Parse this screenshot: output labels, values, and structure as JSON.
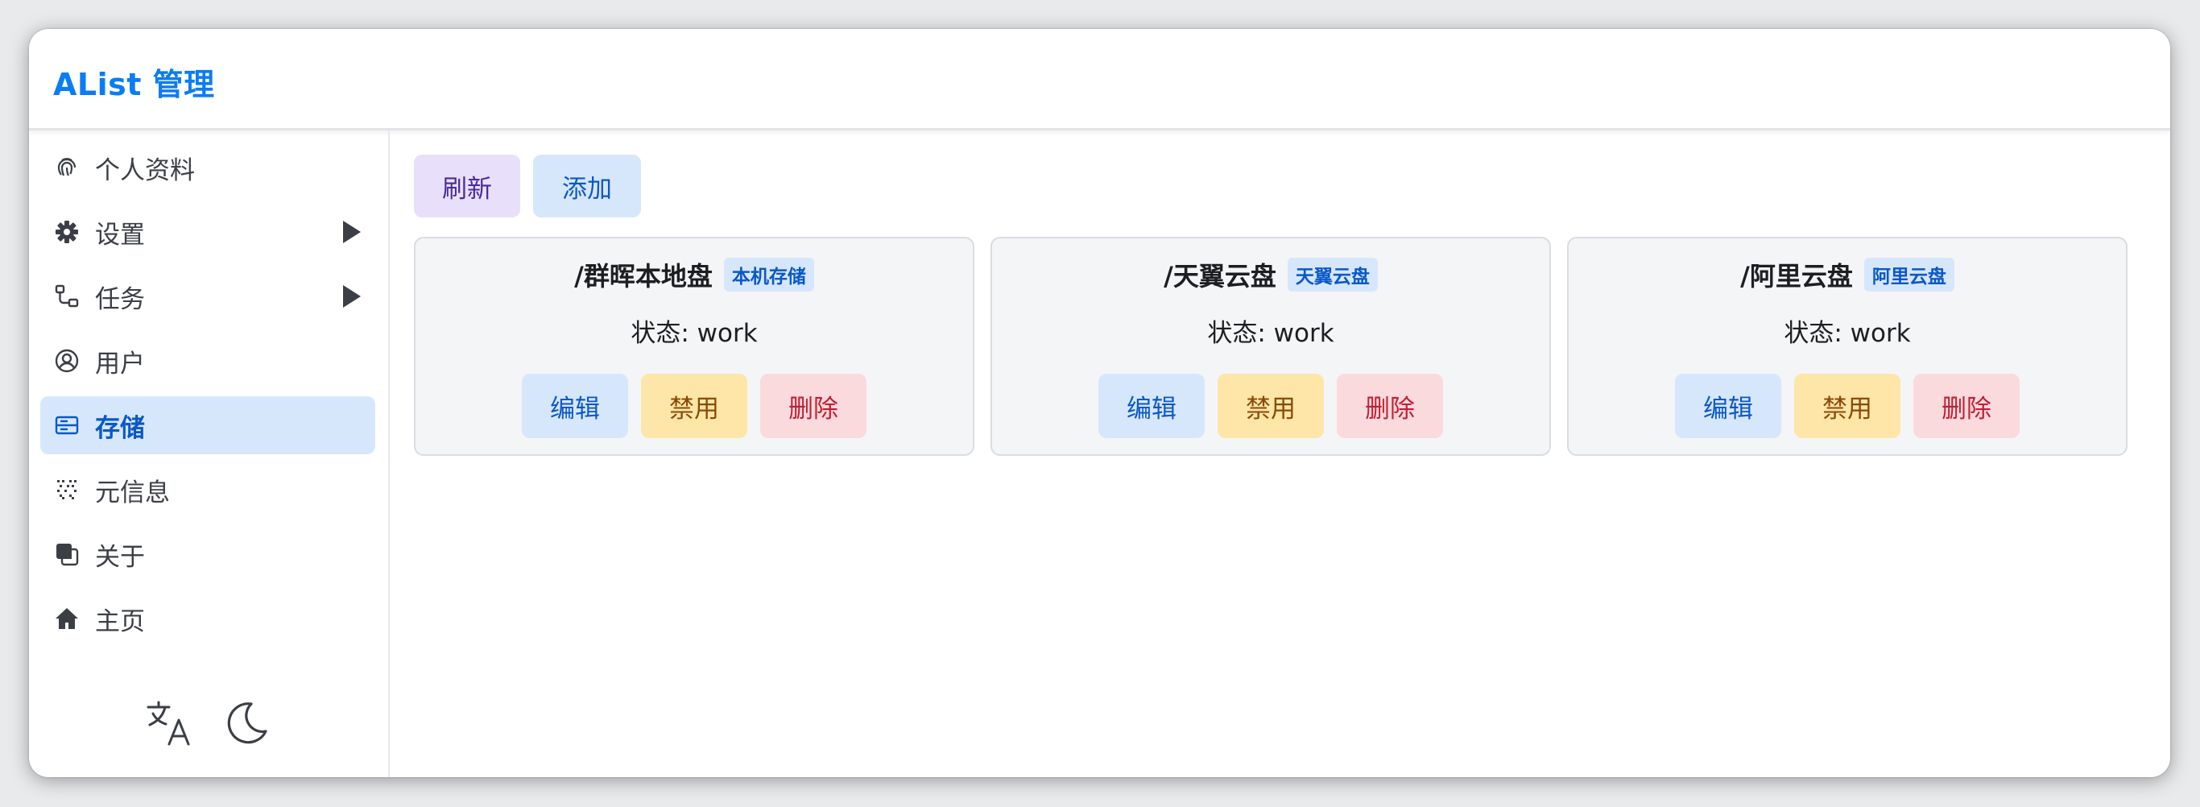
{
  "app": {
    "title": "AList 管理"
  },
  "sidebar": {
    "items": [
      {
        "label": "个人资料",
        "icon": "fingerprint-icon"
      },
      {
        "label": "设置",
        "icon": "gear-icon"
      },
      {
        "label": "任务",
        "icon": "tasks-icon"
      },
      {
        "label": "用户",
        "icon": "user-circle-icon"
      },
      {
        "label": "存储",
        "icon": "storage-icon"
      },
      {
        "label": "元信息",
        "icon": "metadata-icon"
      },
      {
        "label": "关于",
        "icon": "about-icon"
      },
      {
        "label": "主页",
        "icon": "home-icon"
      }
    ],
    "active": "存储"
  },
  "toolbar": {
    "refresh_label": "刷新",
    "add_label": "添加"
  },
  "storages": [
    {
      "path": "/群晖本地盘",
      "driver": "本机存储",
      "status": "状态: work"
    },
    {
      "path": "/天翼云盘",
      "driver": "天翼云盘",
      "status": "状态: work"
    },
    {
      "path": "/阿里云盘",
      "driver": "阿里云盘",
      "status": "状态: work"
    }
  ],
  "card_actions": {
    "edit": "编辑",
    "disable": "禁用",
    "delete": "删除"
  },
  "footer_icons": [
    "translate-icon",
    "moon-icon"
  ],
  "colors": {
    "brand": "#0b7cf5",
    "active_bg": "#d7e7fb",
    "info": "#0a58c8",
    "warning_bg": "#fde6a8",
    "danger_bg": "#fbdadd",
    "refresh_bg": "#e8e0fb"
  }
}
